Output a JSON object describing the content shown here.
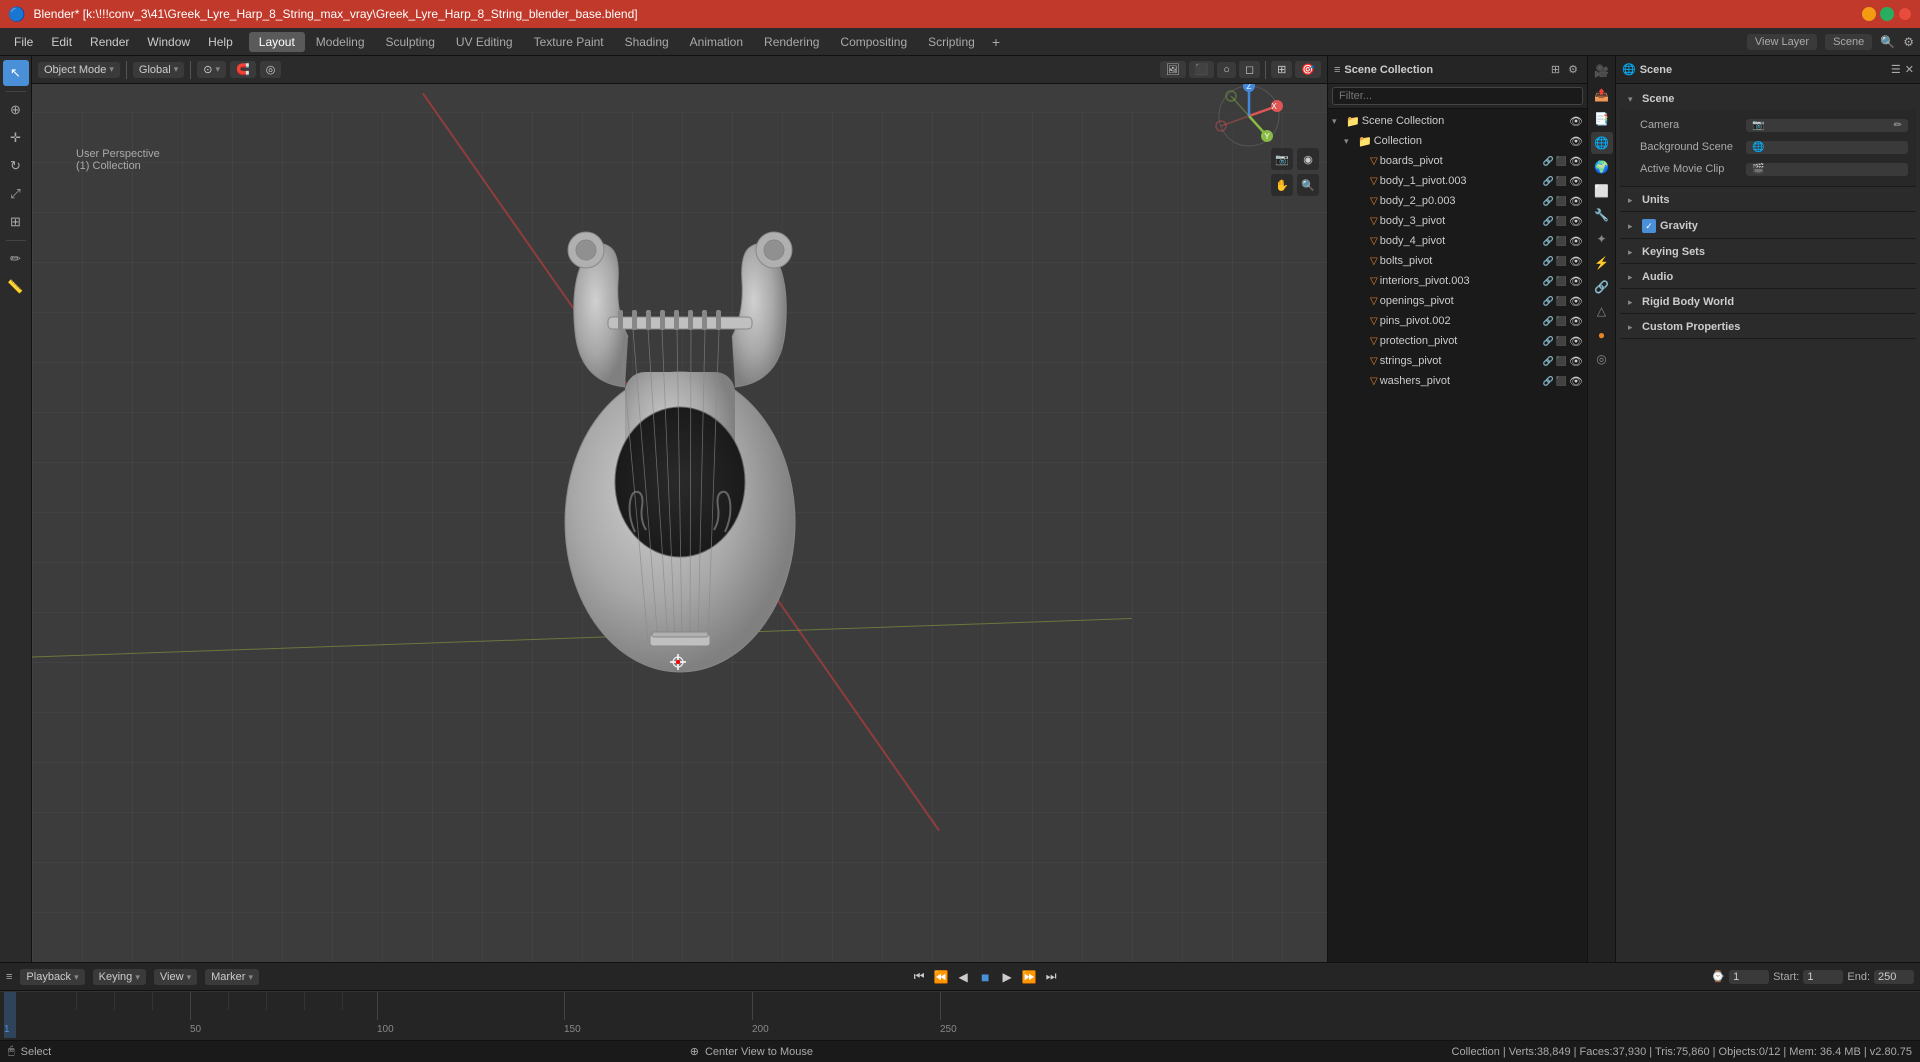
{
  "titlebar": {
    "title": "Blender* [k:\\!!!conv_3\\41\\Greek_Lyre_Harp_8_String_max_vray\\Greek_Lyre_Harp_8_String_blender_base.blend]",
    "appname": "Blender*"
  },
  "menubar": {
    "menus": [
      "File",
      "Edit",
      "Render",
      "Window",
      "Help"
    ],
    "workspaces": [
      "Layout",
      "Modeling",
      "Sculpting",
      "UV Editing",
      "Texture Paint",
      "Shading",
      "Animation",
      "Rendering",
      "Compositing",
      "Scripting"
    ],
    "active_workspace": "Layout",
    "plus": "+"
  },
  "viewport": {
    "mode_label": "Object Mode",
    "shading": "Global",
    "view_label": "User Perspective",
    "collection_label": "(1) Collection",
    "header_btns": [
      "Object Mode",
      "Global",
      "Individual Origins"
    ]
  },
  "outliner": {
    "title": "Scene Collection",
    "items": [
      {
        "label": "Collection",
        "icon": "collection",
        "indent": 0,
        "expanded": true
      },
      {
        "label": "boards_pivot",
        "icon": "mesh",
        "indent": 1
      },
      {
        "label": "body_1_pivot.003",
        "icon": "mesh",
        "indent": 1
      },
      {
        "label": "body_2_p0.003",
        "icon": "mesh",
        "indent": 1
      },
      {
        "label": "body_3_pivot",
        "icon": "mesh",
        "indent": 1
      },
      {
        "label": "body_4_pivot",
        "icon": "mesh",
        "indent": 1
      },
      {
        "label": "bolts_pivot",
        "icon": "mesh",
        "indent": 1
      },
      {
        "label": "interiors_pivot.003",
        "icon": "mesh",
        "indent": 1
      },
      {
        "label": "openings_pivot",
        "icon": "mesh",
        "indent": 1
      },
      {
        "label": "pins_pivot.002",
        "icon": "mesh",
        "indent": 1
      },
      {
        "label": "protection_pivot",
        "icon": "mesh",
        "indent": 1
      },
      {
        "label": "strings_pivot",
        "icon": "mesh",
        "indent": 1
      },
      {
        "label": "washers_pivot",
        "icon": "mesh",
        "indent": 1
      }
    ]
  },
  "properties": {
    "title": "Scene",
    "active_tab": "scene",
    "tabs": [
      "render",
      "output",
      "view-layer",
      "scene",
      "world",
      "object",
      "modifier",
      "particles",
      "physics",
      "constraints",
      "object-data",
      "material",
      "shader",
      "object-properties"
    ],
    "scene_section": {
      "label": "Scene",
      "camera_label": "Camera",
      "camera_value": "",
      "background_scene_label": "Background Scene",
      "background_scene_value": "",
      "active_movie_clip_label": "Active Movie Clip",
      "active_movie_clip_value": ""
    },
    "units_section": {
      "label": "Units"
    },
    "gravity_section": {
      "label": "Gravity",
      "enabled": true
    },
    "keying_sets_section": {
      "label": "Keying Sets"
    },
    "audio_section": {
      "label": "Audio"
    },
    "rigid_body_world_section": {
      "label": "Rigid Body World"
    },
    "custom_properties_section": {
      "label": "Custom Properties"
    }
  },
  "timeline": {
    "playback_label": "Playback",
    "keying_label": "Keying",
    "view_label": "View",
    "marker_label": "Marker",
    "frame_current": "1",
    "frame_start": "1",
    "frame_end": "250",
    "start_label": "Start:",
    "end_label": "End:",
    "marks": [
      1,
      50,
      100,
      150,
      200,
      250
    ]
  },
  "statusbar": {
    "left": "Select",
    "center": "Center View to Mouse",
    "right": "Collection | Verts:38,849 | Faces:37,930 | Tris:75,860 | Objects:0/12 | Mem: 36.4 MB | v2.80.75"
  },
  "view_layer": {
    "label": "View Layer"
  },
  "gizmo": {
    "x_color": "#e05555",
    "y_color": "#88bb44",
    "z_color": "#4488dd"
  }
}
